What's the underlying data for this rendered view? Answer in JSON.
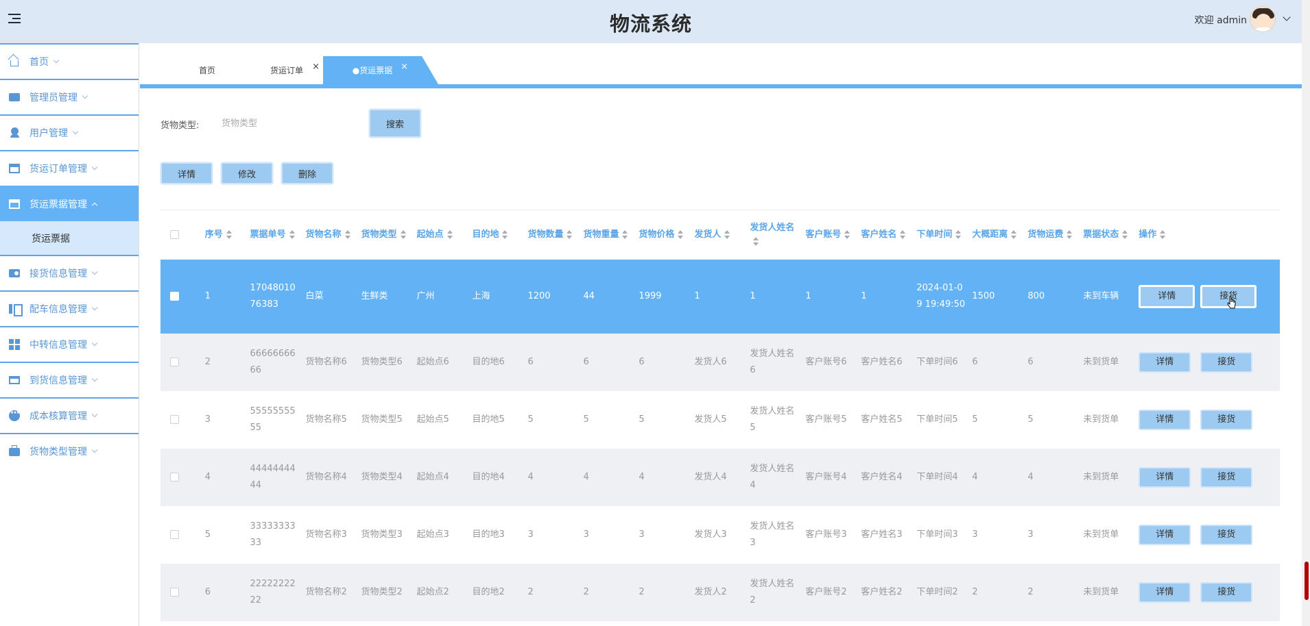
{
  "header": {
    "title": "物流系统",
    "welcome": "欢迎 admin"
  },
  "sidebar": {
    "items": [
      {
        "label": "首页",
        "icon": "home-icon"
      },
      {
        "label": "管理员管理",
        "icon": "envelope-icon"
      },
      {
        "label": "用户管理",
        "icon": "user-icon"
      },
      {
        "label": "货运订单管理",
        "icon": "inbox-icon"
      },
      {
        "label": "货运票据管理",
        "icon": "drawer-icon",
        "active": true,
        "sub": [
          "货运票据"
        ]
      },
      {
        "label": "接货信息管理",
        "icon": "key-icon"
      },
      {
        "label": "配车信息管理",
        "icon": "columns-icon"
      },
      {
        "label": "中转信息管理",
        "icon": "grid-icon"
      },
      {
        "label": "到货信息管理",
        "icon": "wallet-icon"
      },
      {
        "label": "成本核算管理",
        "icon": "dots-icon"
      },
      {
        "label": "货物类型管理",
        "icon": "briefcase-icon"
      }
    ]
  },
  "tabs": [
    {
      "label": "首页"
    },
    {
      "label": "货运订单",
      "close": "×"
    },
    {
      "label": "●货运票据",
      "close": "×",
      "active": true
    }
  ],
  "search": {
    "label": "货物类型:",
    "placeholder": "货物类型",
    "button": "搜索"
  },
  "toolbar": {
    "detail": "详情",
    "edit": "修改",
    "delete": "删除"
  },
  "table": {
    "columns": [
      "序号",
      "票据单号",
      "货物名称",
      "货物类型",
      "起始点",
      "目的地",
      "货物数量",
      "货物重量",
      "货物价格",
      "发货人",
      "发货人姓名",
      "客户账号",
      "客户姓名",
      "下单时间",
      "大概距离",
      "货物运费",
      "票据状态",
      "操作"
    ],
    "rows": [
      [
        "1",
        "1704801076383",
        "白菜",
        "生鲜类",
        "广州",
        "上海",
        "1200",
        "44",
        "1999",
        "1",
        "1",
        "1",
        "1",
        "2024-01-09 19:49:50",
        "1500",
        "800",
        "未到车辆"
      ],
      [
        "2",
        "6666666666",
        "货物名称6",
        "货物类型6",
        "起始点6",
        "目的地6",
        "6",
        "6",
        "6",
        "发货人6",
        "发货人姓名6",
        "客户账号6",
        "客户姓名6",
        "下单时间6",
        "6",
        "6",
        "未到货单"
      ],
      [
        "3",
        "5555555555",
        "货物名称5",
        "货物类型5",
        "起始点5",
        "目的地5",
        "5",
        "5",
        "5",
        "发货人5",
        "发货人姓名5",
        "客户账号5",
        "客户姓名5",
        "下单时间5",
        "5",
        "5",
        "未到货单"
      ],
      [
        "4",
        "4444444444",
        "货物名称4",
        "货物类型4",
        "起始点4",
        "目的地4",
        "4",
        "4",
        "4",
        "发货人4",
        "发货人姓名4",
        "客户账号4",
        "客户姓名4",
        "下单时间4",
        "4",
        "4",
        "未到货单"
      ],
      [
        "5",
        "3333333333",
        "货物名称3",
        "货物类型3",
        "起始点3",
        "目的地3",
        "3",
        "3",
        "3",
        "发货人3",
        "发货人姓名3",
        "客户账号3",
        "客户姓名3",
        "下单时间3",
        "3",
        "3",
        "未到货单"
      ],
      [
        "6",
        "2222222222",
        "货物名称2",
        "货物类型2",
        "起始点2",
        "目的地2",
        "2",
        "2",
        "2",
        "发货人2",
        "发货人姓名2",
        "客户账号2",
        "客户姓名2",
        "下单时间2",
        "2",
        "2",
        "未到货单"
      ]
    ],
    "row_actions": {
      "detail": "详情",
      "receive": "接货"
    }
  },
  "colors": {
    "accent": "#63b2f5",
    "header_bg": "#dce8f6",
    "button_bg": "#9ccaf1",
    "header_text": "#5aa5e8"
  }
}
